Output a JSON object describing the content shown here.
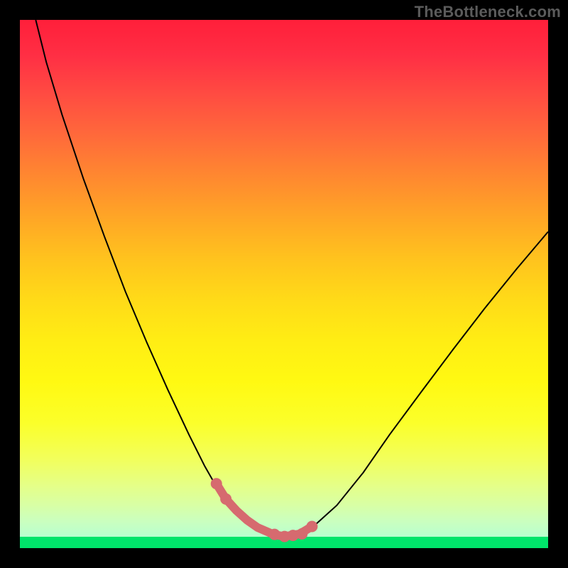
{
  "watermark": "TheBottleneck.com",
  "chart_data": {
    "type": "line",
    "title": "",
    "xlabel": "",
    "ylabel": "",
    "xlim": [
      0,
      100
    ],
    "ylim": [
      0,
      100
    ],
    "grid": false,
    "series": [
      {
        "name": "curve",
        "color": "#000000",
        "stroke_width": 2,
        "x": [
          3,
          5,
          8,
          12,
          16,
          20,
          24,
          28,
          32,
          35,
          37,
          39,
          41,
          43,
          45,
          48,
          50,
          53,
          56,
          60,
          65,
          70,
          76,
          82,
          88,
          94,
          100
        ],
        "y": [
          100,
          92,
          82,
          70,
          59,
          48.5,
          39,
          30,
          21.5,
          15.5,
          12,
          9.3,
          7.1,
          5.3,
          3.9,
          2.6,
          2.2,
          2.7,
          4.5,
          8.1,
          14.3,
          21.5,
          29.6,
          37.6,
          45.4,
          52.8,
          59.9
        ]
      },
      {
        "name": "marker-segment",
        "color": "#d66a6f",
        "stroke_width": 12,
        "x": [
          37.2,
          39,
          41,
          43,
          45,
          48,
          50,
          53,
          55.3
        ],
        "y": [
          12.2,
          9.3,
          7.1,
          5.3,
          3.9,
          2.6,
          2.2,
          2.7,
          4.1
        ]
      }
    ],
    "marker_points": {
      "name": "marker-dots",
      "color": "#d66a6f",
      "radius": 8,
      "x": [
        37.2,
        39.0,
        48.2,
        50.1,
        51.7,
        53.4,
        55.3
      ],
      "y": [
        12.2,
        9.3,
        2.6,
        2.2,
        2.4,
        2.7,
        4.1
      ]
    },
    "background_gradient": {
      "stops": [
        {
          "pos": 0.0,
          "color": "#ff1f3a"
        },
        {
          "pos": 0.5,
          "color": "#ffd01a"
        },
        {
          "pos": 0.8,
          "color": "#f7ff35"
        },
        {
          "pos": 1.0,
          "color": "#b8ffcf"
        }
      ]
    },
    "ground_color": "#00e46a"
  }
}
